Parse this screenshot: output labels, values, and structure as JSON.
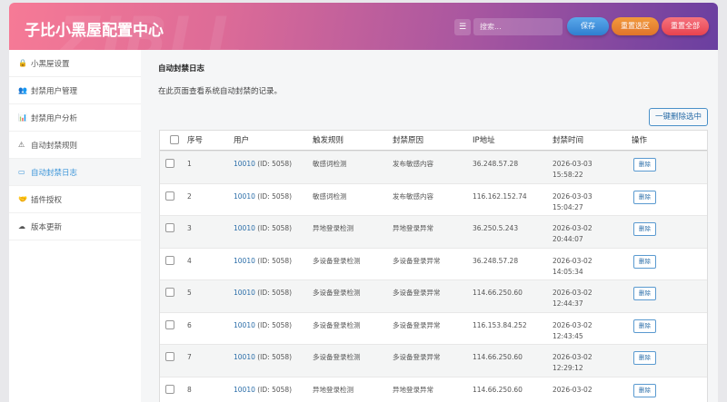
{
  "header": {
    "title": "子比小黑屋配置中心",
    "watermark": "ZIBLL",
    "search_placeholder": "搜索...",
    "save": "保存",
    "reset_section": "重置选区",
    "reset_all": "重置全部"
  },
  "sidebar": {
    "items": [
      {
        "label": "小黑屋设置",
        "icon": "lock-icon",
        "glyph": "🔒"
      },
      {
        "label": "封禁用户管理",
        "icon": "users-icon",
        "glyph": "👥"
      },
      {
        "label": "封禁用户分析",
        "icon": "bar-chart-icon",
        "glyph": "📊"
      },
      {
        "label": "自动封禁规则",
        "icon": "warning-icon",
        "glyph": "⚠"
      },
      {
        "label": "自动封禁日志",
        "icon": "window-icon",
        "glyph": "▭"
      },
      {
        "label": "插件授权",
        "icon": "handshake-icon",
        "glyph": "🤝"
      },
      {
        "label": "版本更新",
        "icon": "cloud-upload-icon",
        "glyph": "☁"
      }
    ],
    "active": 4
  },
  "main": {
    "title": "自动封禁日志",
    "description": "在此页面查看系统自动封禁的记录。",
    "bulk_delete": "一键删除选中",
    "columns": [
      "序号",
      "用户",
      "触发规则",
      "封禁原因",
      "IP地址",
      "封禁时间",
      "操作"
    ],
    "delete_label": "删除",
    "rows": [
      {
        "no": "1",
        "user": "10010",
        "uid": "(ID: 5058)",
        "rule": "敏感词检测",
        "reason": "发布敏感内容",
        "ip": "36.248.57.28",
        "date": "2026-03-03",
        "time": "15:58:22"
      },
      {
        "no": "2",
        "user": "10010",
        "uid": "(ID: 5058)",
        "rule": "敏感词检测",
        "reason": "发布敏感内容",
        "ip": "116.162.152.74",
        "date": "2026-03-03",
        "time": "15:04:27"
      },
      {
        "no": "3",
        "user": "10010",
        "uid": "(ID: 5058)",
        "rule": "异地登录检测",
        "reason": "异地登录异常",
        "ip": "36.250.5.243",
        "date": "2026-03-02",
        "time": "20:44:07"
      },
      {
        "no": "4",
        "user": "10010",
        "uid": "(ID: 5058)",
        "rule": "多设备登录检测",
        "reason": "多设备登录异常",
        "ip": "36.248.57.28",
        "date": "2026-03-02",
        "time": "14:05:34"
      },
      {
        "no": "5",
        "user": "10010",
        "uid": "(ID: 5058)",
        "rule": "多设备登录检测",
        "reason": "多设备登录异常",
        "ip": "114.66.250.60",
        "date": "2026-03-02",
        "time": "12:44:37"
      },
      {
        "no": "6",
        "user": "10010",
        "uid": "(ID: 5058)",
        "rule": "多设备登录检测",
        "reason": "多设备登录异常",
        "ip": "116.153.84.252",
        "date": "2026-03-02",
        "time": "12:43:45"
      },
      {
        "no": "7",
        "user": "10010",
        "uid": "(ID: 5058)",
        "rule": "多设备登录检测",
        "reason": "多设备登录异常",
        "ip": "114.66.250.60",
        "date": "2026-03-02",
        "time": "12:29:12"
      },
      {
        "no": "8",
        "user": "10010",
        "uid": "(ID: 5058)",
        "rule": "异地登录检测",
        "reason": "异地登录异常",
        "ip": "114.66.250.60",
        "date": "2026-03-02"
      }
    ]
  }
}
